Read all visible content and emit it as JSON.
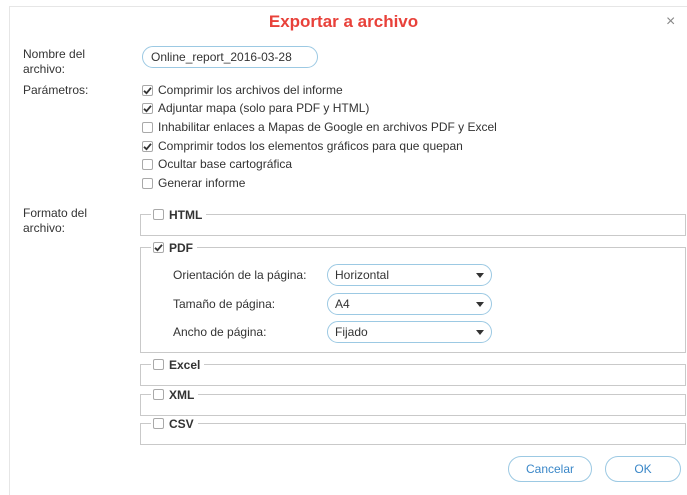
{
  "dialog": {
    "title": "Exportar a archivo",
    "close_symbol": "×",
    "close_icon": "close-icon"
  },
  "file_name": {
    "label": "Nombre del archivo:",
    "value": "Online_report_2016-03-28"
  },
  "parameters": {
    "label": "Parámetros:",
    "options": [
      {
        "label": "Comprimir los archivos del informe",
        "checked": true
      },
      {
        "label": "Adjuntar mapa (solo para PDF y HTML)",
        "checked": true
      },
      {
        "label": "Inhabilitar enlaces a Mapas de Google en archivos PDF y Excel",
        "checked": false
      },
      {
        "label": "Comprimir todos los elementos gráficos para que quepan",
        "checked": true
      },
      {
        "label": "Ocultar base cartográfica",
        "checked": false
      },
      {
        "label": "Generar informe",
        "checked": false
      }
    ]
  },
  "format": {
    "label": "Formato del archivo:",
    "html": {
      "label": "HTML",
      "checked": false
    },
    "pdf": {
      "label": "PDF",
      "checked": true,
      "orientation": {
        "label": "Orientación de la página:",
        "value": "Horizontal"
      },
      "page_size": {
        "label": "Tamaño de página:",
        "value": "A4"
      },
      "page_width": {
        "label": "Ancho de página:",
        "value": "Fijado"
      }
    },
    "excel": {
      "label": "Excel",
      "checked": false
    },
    "xml": {
      "label": "XML",
      "checked": false
    },
    "csv": {
      "label": "CSV",
      "checked": false
    }
  },
  "buttons": {
    "cancel": "Cancelar",
    "ok": "OK"
  },
  "colors": {
    "title": "#e8413a",
    "button_text": "#3a87c8",
    "input_border": "#9cc9e3"
  }
}
